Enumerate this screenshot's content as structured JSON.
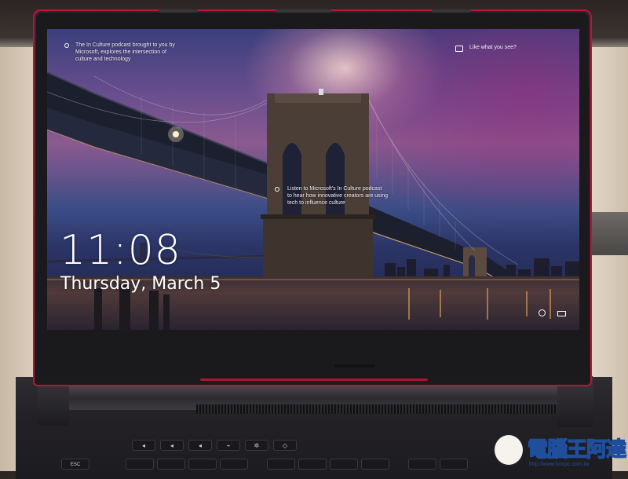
{
  "lock_screen": {
    "podcast_teaser": {
      "line1": "The In Culture podcast brought to you by",
      "line2": "Microsoft, explores the intersection of",
      "line3": "culture and technology"
    },
    "info_callout": {
      "line1": "Listen to Microsoft's In Culture podcast",
      "line2": "to hear how innovative creators are using",
      "line3": "tech to influence culture"
    },
    "like_prompt": "Like what you see?",
    "time": "11:08",
    "date": "Thursday, March 5"
  },
  "keyboard": {
    "esc_label": "ESC"
  },
  "watermark": {
    "brand": "電腦王阿達",
    "url": "http://www.kocpc.com.tw"
  },
  "colors": {
    "accent_red": "#c2103a",
    "brand_blue": "#1f4f9c"
  },
  "icons": [
    "info-icon",
    "camera-icon",
    "network-icon",
    "battery-icon"
  ]
}
